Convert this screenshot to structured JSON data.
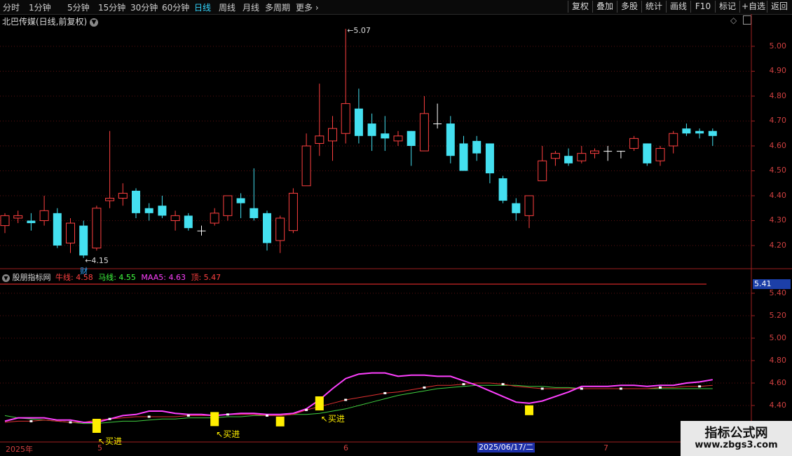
{
  "toolbar": {
    "periods": [
      "分时",
      "1分钟",
      "5分钟",
      "15分钟",
      "30分钟",
      "60分钟",
      "日线",
      "周线",
      "月线",
      "多周期",
      "更多"
    ],
    "active_period": "日线",
    "more_chevron": "›",
    "right_buttons": [
      "复权",
      "叠加",
      "多股",
      "统计",
      "画线",
      "F10",
      "标记",
      "+自选",
      "返回"
    ]
  },
  "main_chart": {
    "title": "北巴传媒(日线,前复权)",
    "price_axis": [
      "5.00",
      "4.90",
      "4.80",
      "4.70",
      "4.60",
      "4.50",
      "4.40",
      "4.30",
      "4.20"
    ],
    "high_label": "5.07",
    "low_label": "4.15",
    "finance_marker": "财"
  },
  "indicator": {
    "name": "股朋指标网",
    "legend": [
      {
        "text": "牛线: 4.58",
        "color": "#ff4040"
      },
      {
        "text": "马线: 4.55",
        "color": "#40ff40"
      },
      {
        "text": "MAA5: 4.63",
        "color": "#ff40ff"
      },
      {
        "text": "顶: 5.47",
        "color": "#ff4040"
      }
    ],
    "axis": [
      "5.40",
      "5.20",
      "5.00",
      "4.80",
      "4.60",
      "4.40"
    ],
    "current_value": "5.41",
    "signals": [
      "↖买进",
      "↖买进",
      "↖买进"
    ]
  },
  "timeline": {
    "labels": [
      "2025年",
      "5",
      "6",
      "7"
    ],
    "cursor_date": "2025/06/17/二"
  },
  "watermark": {
    "title": "指标公式网",
    "url": "www.zbgs3.com"
  },
  "colors": {
    "up": "#ff4040",
    "down": "#44e0f0",
    "niu": "#e03030",
    "ma": "#40d040",
    "maa5": "#ff40ff",
    "signal": "#ffee00"
  },
  "chart_data": {
    "type": "candlestick",
    "candles": [
      [
        4.28,
        4.32,
        4.33,
        4.25
      ],
      [
        4.31,
        4.32,
        4.34,
        4.29
      ],
      [
        4.3,
        4.29,
        4.33,
        4.26
      ],
      [
        4.3,
        4.34,
        4.4,
        4.28
      ],
      [
        4.33,
        4.2,
        4.35,
        4.19
      ],
      [
        4.21,
        4.29,
        4.31,
        4.17
      ],
      [
        4.28,
        4.16,
        4.3,
        4.15
      ],
      [
        4.19,
        4.35,
        4.36,
        4.18
      ],
      [
        4.38,
        4.39,
        4.66,
        4.35
      ],
      [
        4.39,
        4.41,
        4.45,
        4.36
      ],
      [
        4.42,
        4.33,
        4.43,
        4.31
      ],
      [
        4.35,
        4.33,
        4.37,
        4.3
      ],
      [
        4.36,
        4.32,
        4.4,
        4.31
      ],
      [
        4.3,
        4.32,
        4.34,
        4.26
      ],
      [
        4.32,
        4.27,
        4.33,
        4.26
      ],
      [
        4.26,
        4.26,
        4.28,
        4.24
      ],
      [
        4.29,
        4.33,
        4.35,
        4.28
      ],
      [
        4.32,
        4.4,
        4.4,
        4.3
      ],
      [
        4.39,
        4.37,
        4.41,
        4.31
      ],
      [
        4.35,
        4.31,
        4.51,
        4.3
      ],
      [
        4.33,
        4.21,
        4.34,
        4.18
      ],
      [
        4.22,
        4.31,
        4.32,
        4.17
      ],
      [
        4.26,
        4.41,
        4.43,
        4.25
      ],
      [
        4.44,
        4.6,
        4.65,
        4.44
      ],
      [
        4.61,
        4.64,
        4.85,
        4.56
      ],
      [
        4.62,
        4.67,
        4.72,
        4.54
      ],
      [
        4.65,
        4.77,
        5.07,
        4.61
      ],
      [
        4.75,
        4.64,
        4.83,
        4.61
      ],
      [
        4.69,
        4.64,
        4.73,
        4.58
      ],
      [
        4.65,
        4.63,
        4.72,
        4.58
      ],
      [
        4.62,
        4.64,
        4.66,
        4.6
      ],
      [
        4.66,
        4.6,
        4.66,
        4.52
      ],
      [
        4.58,
        4.73,
        4.8,
        4.58
      ],
      [
        4.69,
        4.69,
        4.77,
        4.67
      ],
      [
        4.69,
        4.56,
        4.72,
        4.53
      ],
      [
        4.61,
        4.5,
        4.64,
        4.5
      ],
      [
        4.62,
        4.57,
        4.64,
        4.54
      ],
      [
        4.61,
        4.49,
        4.61,
        4.45
      ],
      [
        4.47,
        4.38,
        4.48,
        4.37
      ],
      [
        4.37,
        4.33,
        4.39,
        4.3
      ],
      [
        4.32,
        4.4,
        4.4,
        4.27
      ],
      [
        4.46,
        4.54,
        4.6,
        4.46
      ],
      [
        4.55,
        4.57,
        4.58,
        4.52
      ],
      [
        4.56,
        4.53,
        4.59,
        4.52
      ],
      [
        4.54,
        4.57,
        4.6,
        4.53
      ],
      [
        4.57,
        4.58,
        4.59,
        4.55
      ],
      [
        4.58,
        4.58,
        4.6,
        4.54
      ],
      [
        4.58,
        4.58,
        4.58,
        4.55
      ],
      [
        4.59,
        4.63,
        4.64,
        4.58
      ],
      [
        4.61,
        4.53,
        4.61,
        4.52
      ],
      [
        4.54,
        4.59,
        4.6,
        4.52
      ],
      [
        4.6,
        4.65,
        4.66,
        4.57
      ],
      [
        4.67,
        4.65,
        4.69,
        4.64
      ],
      [
        4.66,
        4.65,
        4.67,
        4.63
      ],
      [
        4.66,
        4.64,
        4.67,
        4.6
      ]
    ],
    "indicator_series": {
      "niu": [
        4.25,
        4.26,
        4.26,
        4.27,
        4.26,
        4.25,
        4.25,
        4.27,
        4.28,
        4.29,
        4.3,
        4.3,
        4.3,
        4.3,
        4.31,
        4.31,
        4.31,
        4.32,
        4.32,
        4.32,
        4.31,
        4.31,
        4.32,
        4.36,
        4.39,
        4.42,
        4.45,
        4.47,
        4.49,
        4.51,
        4.52,
        4.54,
        4.56,
        4.58,
        4.58,
        4.59,
        4.6,
        4.6,
        4.59,
        4.57,
        4.56,
        4.55,
        4.55,
        4.55,
        4.55,
        4.55,
        4.55,
        4.55,
        4.55,
        4.55,
        4.56,
        4.56,
        4.57,
        4.57,
        4.58
      ],
      "ma": [
        4.31,
        4.29,
        4.28,
        4.27,
        4.26,
        4.25,
        4.24,
        4.24,
        4.25,
        4.26,
        4.26,
        4.27,
        4.28,
        4.28,
        4.29,
        4.29,
        4.29,
        4.3,
        4.3,
        4.31,
        4.31,
        4.31,
        4.32,
        4.32,
        4.33,
        4.35,
        4.37,
        4.4,
        4.43,
        4.46,
        4.49,
        4.51,
        4.53,
        4.55,
        4.56,
        4.57,
        4.58,
        4.58,
        4.58,
        4.58,
        4.57,
        4.57,
        4.56,
        4.56,
        4.55,
        4.55,
        4.55,
        4.55,
        4.55,
        4.55,
        4.55,
        4.55,
        4.55,
        4.55,
        4.55
      ],
      "maa5": [
        4.26,
        4.29,
        4.29,
        4.29,
        4.27,
        4.27,
        4.25,
        4.25,
        4.28,
        4.31,
        4.32,
        4.35,
        4.35,
        4.33,
        4.32,
        4.32,
        4.31,
        4.32,
        4.33,
        4.33,
        4.32,
        4.32,
        4.33,
        4.37,
        4.45,
        4.55,
        4.64,
        4.68,
        4.69,
        4.69,
        4.66,
        4.67,
        4.67,
        4.66,
        4.66,
        4.62,
        4.58,
        4.53,
        4.48,
        4.43,
        4.42,
        4.44,
        4.48,
        4.52,
        4.57,
        4.57,
        4.57,
        4.58,
        4.58,
        4.57,
        4.58,
        4.58,
        4.6,
        4.61,
        4.63
      ],
      "buy_signal_indices": [
        7,
        16,
        24
      ]
    }
  }
}
